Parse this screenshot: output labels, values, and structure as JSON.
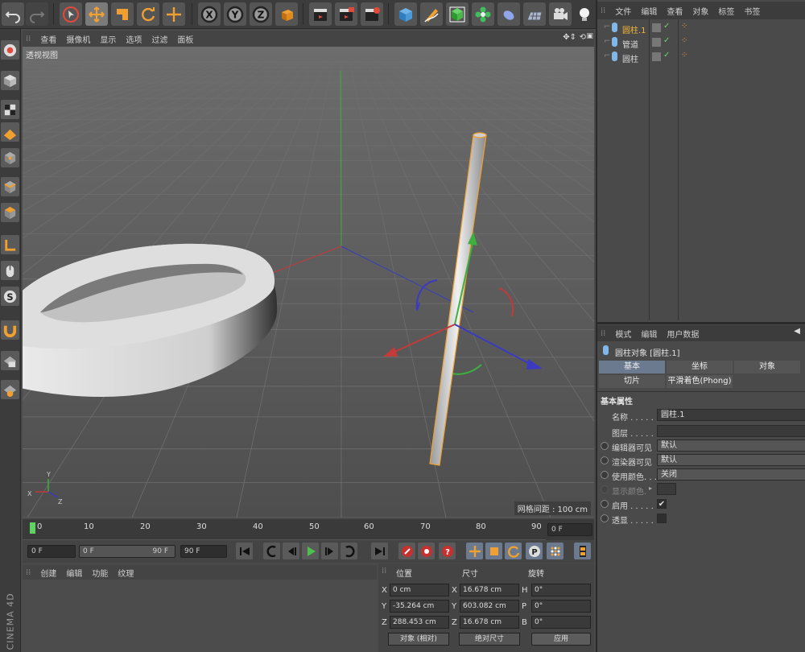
{
  "viewport": {
    "menu": [
      "查看",
      "摄像机",
      "显示",
      "选项",
      "过滤",
      "面板"
    ],
    "label": "透视视图",
    "grid_label": "网格间距 : 100 cm"
  },
  "timeline": {
    "ticks": [
      "0",
      "10",
      "20",
      "30",
      "40",
      "50",
      "60",
      "70",
      "80",
      "90"
    ],
    "end_field": "0 F",
    "start_field": "0 F",
    "range_start": "0 F",
    "range_end": "90 F",
    "max_field": "90 F"
  },
  "material": {
    "menu": [
      "创建",
      "编辑",
      "功能",
      "纹理"
    ]
  },
  "coords": {
    "headers": [
      "位置",
      "尺寸",
      "旋转"
    ],
    "rows": [
      {
        "axis": "X",
        "pos": "0 cm",
        "size_axis": "X",
        "size": "16.678 cm",
        "rot_axis": "H",
        "rot": "0°"
      },
      {
        "axis": "Y",
        "pos": "-35.264 cm",
        "size_axis": "Y",
        "size": "603.082 cm",
        "rot_axis": "P",
        "rot": "0°"
      },
      {
        "axis": "Z",
        "pos": "288.453 cm",
        "size_axis": "Z",
        "size": "16.678 cm",
        "rot_axis": "B",
        "rot": "0°"
      }
    ],
    "mode": "对象 (相对)",
    "size_mode": "绝对尺寸",
    "apply": "应用"
  },
  "objects": {
    "menu": [
      "文件",
      "编辑",
      "查看",
      "对象",
      "标签",
      "书签"
    ],
    "items": [
      {
        "name": "圆柱.1",
        "selected": true
      },
      {
        "name": "管道",
        "selected": false
      },
      {
        "name": "圆柱",
        "selected": false
      }
    ]
  },
  "attributes": {
    "menu": [
      "模式",
      "编辑",
      "用户数据"
    ],
    "title": "圆柱对象 [圆柱.1]",
    "tabs": [
      "基本",
      "坐标",
      "对象",
      "切片",
      "平滑着色(Phong)"
    ],
    "section": "基本属性",
    "fields": [
      {
        "label": "名称 . . . . .",
        "value": "圆柱.1"
      },
      {
        "label": "图层 . . . . .",
        "value": ""
      },
      {
        "label": "编辑器可见",
        "value": "默认"
      },
      {
        "label": "渲染器可见",
        "value": "默认"
      },
      {
        "label": "使用颜色. . .",
        "value": "关闭"
      },
      {
        "label": "显示颜色.",
        "value": ""
      },
      {
        "label": "启用 . . . . .",
        "value": "✔"
      },
      {
        "label": "透显 . . . . .",
        "value": ""
      }
    ]
  },
  "brand": "CINEMA 4D",
  "colors": {
    "accent": "#f0a030",
    "selected_text": "#f3b63c",
    "tab_active": "#6b7a8f"
  }
}
